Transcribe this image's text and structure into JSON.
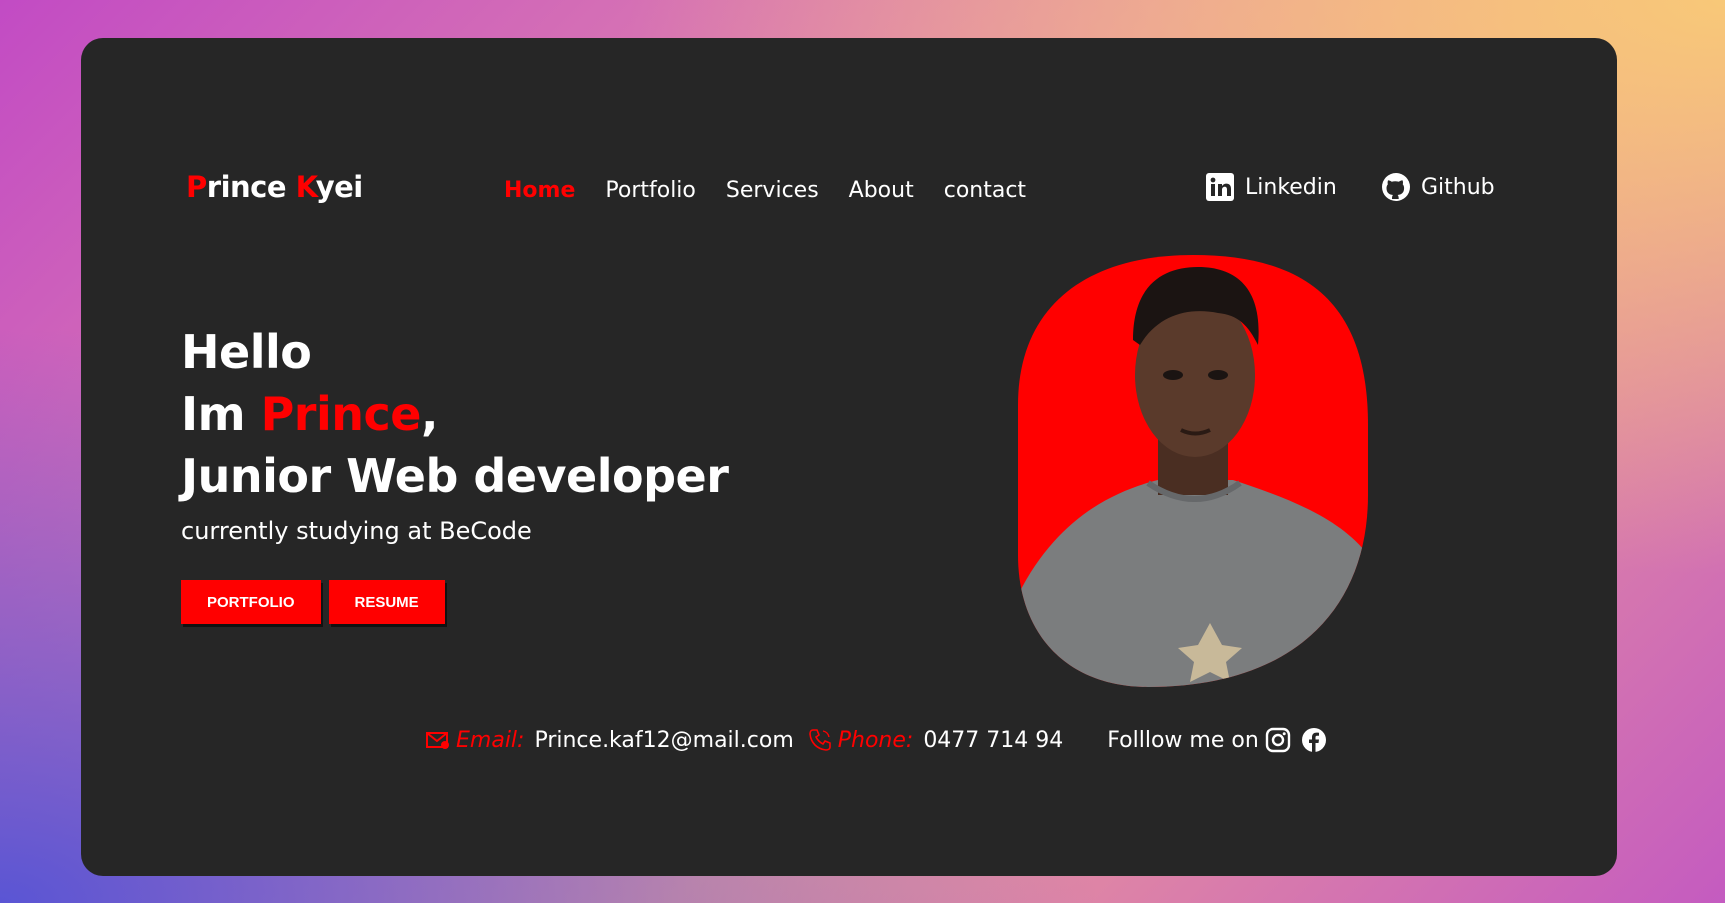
{
  "brand": {
    "first_initial": "P",
    "first_rest": "rince ",
    "last_initial": "K",
    "last_rest": "yei"
  },
  "nav": [
    {
      "label": "Home",
      "active": true
    },
    {
      "label": "Portfolio"
    },
    {
      "label": "Services"
    },
    {
      "label": "About"
    },
    {
      "label": "contact"
    }
  ],
  "social": {
    "linkedin": {
      "label": "Linkedin",
      "icon": "linkedin-icon"
    },
    "github": {
      "label": "Github",
      "icon": "github-icon"
    }
  },
  "hero": {
    "line1": "Hello",
    "line2_prefix": "Im ",
    "line2_name": "Prince",
    "line2_suffix": ",",
    "line3": "Junior Web developer",
    "subtitle": "currently studying at BeCode"
  },
  "buttons": {
    "portfolio": "PORTFOLIO",
    "resume": "RESUME"
  },
  "contact": {
    "email_label": "Email:",
    "email": "Prince.kaf12@mail.com",
    "phone_label": "Phone:",
    "phone": "0477 714 94",
    "follow": "Folllow me on"
  },
  "colors": {
    "accent": "#ff0000",
    "card": "#262626"
  }
}
